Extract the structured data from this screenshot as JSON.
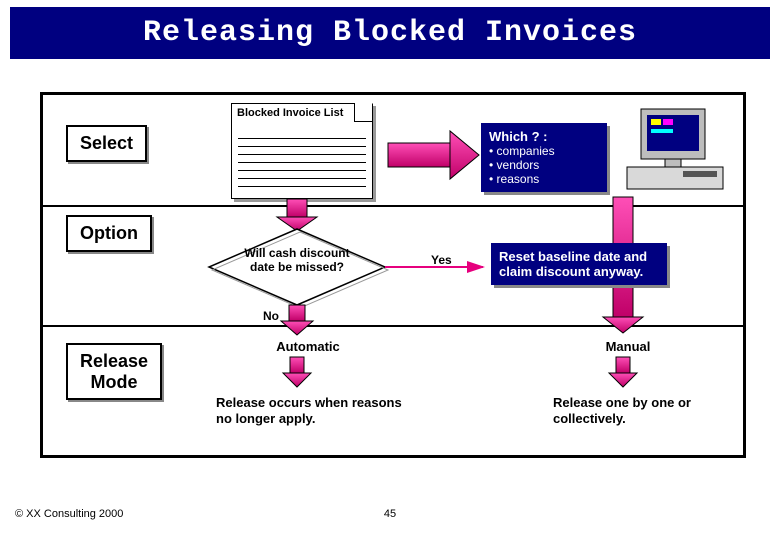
{
  "title": "Releasing Blocked Invoices",
  "sections": {
    "select": "Select",
    "option": "Option",
    "release": "Release\nMode"
  },
  "doc_title": "Blocked Invoice List",
  "criteria": {
    "head": "Which ? :",
    "items": [
      "companies",
      "vendors",
      "reasons"
    ]
  },
  "decision": {
    "question": "Will cash discount date be missed?",
    "yes": "Yes",
    "no": "No",
    "action": "Reset baseline date and claim discount anyway."
  },
  "modes": {
    "automatic": {
      "label": "Automatic",
      "note": "Release occurs when reasons no longer apply."
    },
    "manual": {
      "label": "Manual",
      "note": "Release one by one or collectively."
    }
  },
  "footer": "© XX Consulting 2000",
  "page": "45",
  "colors": {
    "navy": "#000080",
    "magenta": "#E6007E"
  }
}
